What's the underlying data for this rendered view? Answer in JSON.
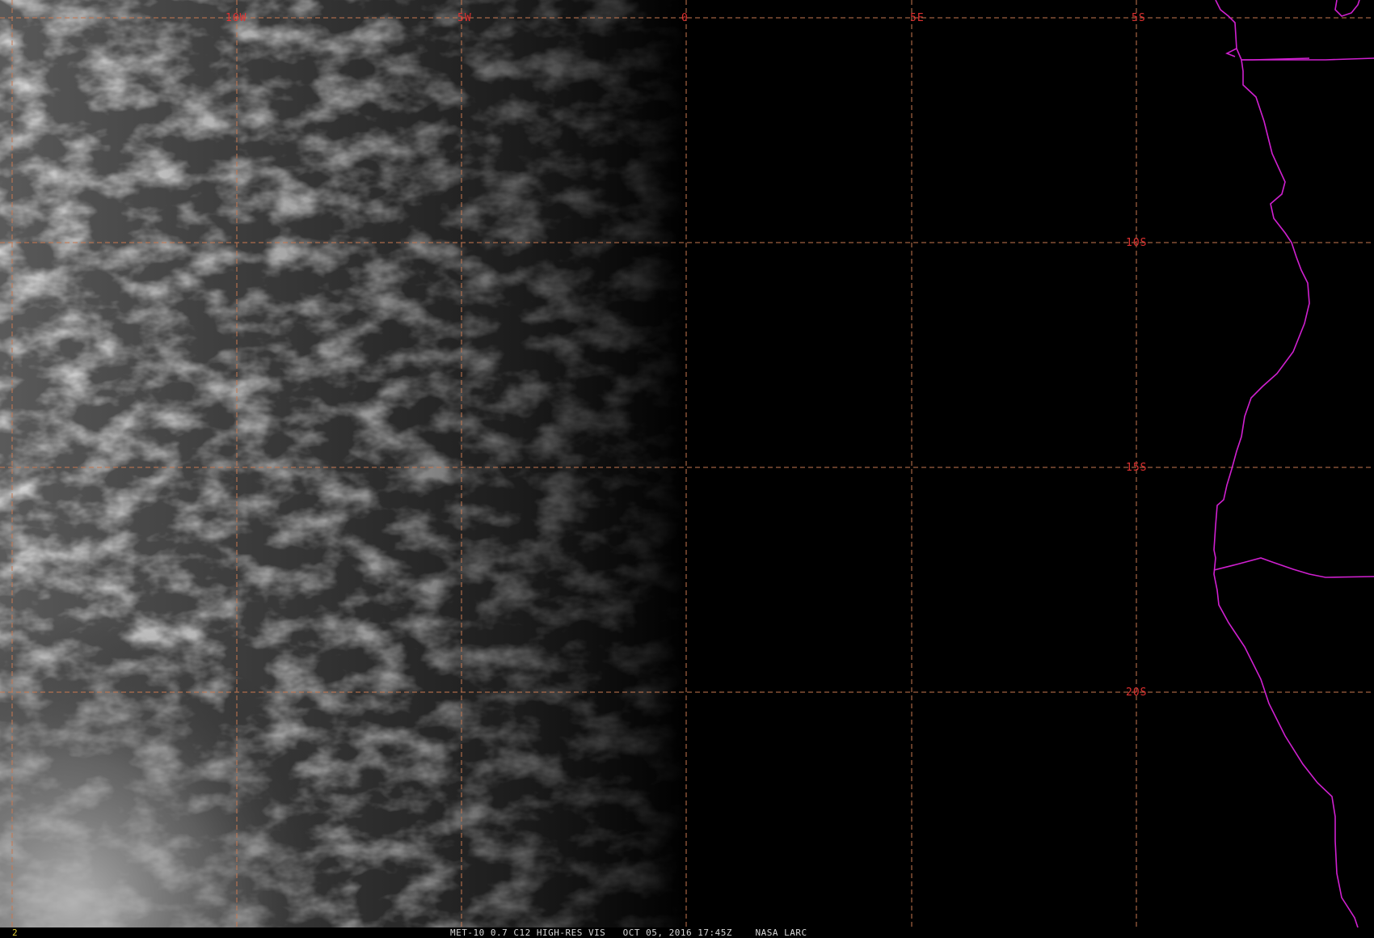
{
  "image": {
    "satellite": "MET-10",
    "channel": "0.7 C12",
    "product": "HIGH-RES VIS",
    "date": "OCT 05, 2016",
    "time": "17:45Z",
    "credit": "NASA LARC",
    "frame_number": "2"
  },
  "caption_text": "MET-10 0.7 C12 HIGH-RES VIS   OCT 05, 2016 17:45Z    NASA LARC",
  "grid": {
    "longitude_labels": [
      "10W",
      "5W",
      "0",
      "5E"
    ],
    "latitude_labels": [
      "5S",
      "10S",
      "15S",
      "20S"
    ],
    "line_color": "#c87850",
    "label_color": "#e03030"
  },
  "coastline_color": "#d020d0",
  "colors": {
    "background": "#000000",
    "cloud": "#d0d0d0"
  }
}
